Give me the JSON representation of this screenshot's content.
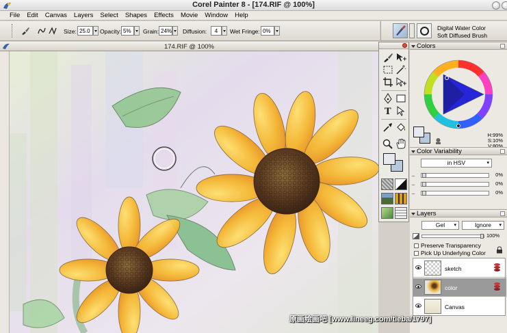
{
  "app": {
    "title": "Corel Painter 8 - [174.RIF @ 100%]"
  },
  "menu": [
    "File",
    "Edit",
    "Canvas",
    "Layers",
    "Select",
    "Shapes",
    "Effects",
    "Movie",
    "Window",
    "Help"
  ],
  "property_bar": {
    "size_label": "Size:",
    "size_value": "25.0",
    "opacity_label": "Opacity:",
    "opacity_value": "5%",
    "grain_label": "Grain:",
    "grain_value": "24%",
    "diffusion_label": "Diffusion:",
    "diffusion_value": "4",
    "wet_fringe_label": "Wet Fringe:",
    "wet_fringe_value": "0%"
  },
  "brush": {
    "category": "Digital Water Color",
    "variant": "Soft Diffused Brush"
  },
  "document": {
    "title": "174.RIF @ 100%"
  },
  "colors_panel": {
    "title": "Colors",
    "h": "H:99%",
    "s": "S:10%",
    "v": "V:80%",
    "primary_color": "#e8e8f0",
    "secondary_color": "#b8c8dc"
  },
  "color_variability": {
    "title": "Color Variability",
    "mode": "in HSV",
    "rows": [
      {
        "value": "0%"
      },
      {
        "value": "0%"
      },
      {
        "value": "0%"
      }
    ]
  },
  "layers_panel": {
    "title": "Layers",
    "composite_method": "Gel",
    "composite_depth": "Ignore",
    "opacity": "100%",
    "preserve_transparency": "Preserve Transparency",
    "pick_up_underlying": "Pick Up Underlying Color",
    "layers": [
      {
        "name": "sketch",
        "selected": false
      },
      {
        "name": "color",
        "selected": true
      },
      {
        "name": "Canvas",
        "selected": false
      }
    ]
  },
  "watermark": "原画绘画吧 [www.lineeg.com/tieba/1797]"
}
